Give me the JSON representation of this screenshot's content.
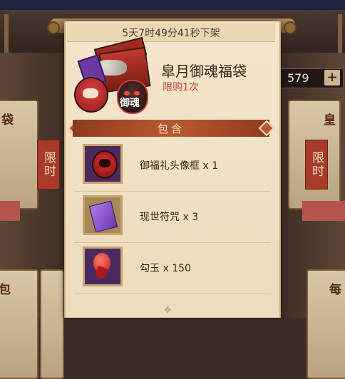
{
  "shop": {
    "currency_value": "579",
    "currency_plus": "+",
    "bg_labels": [
      "袋",
      "皇",
      "包",
      "每"
    ],
    "bg_tags": [
      "限时",
      "限时"
    ]
  },
  "popup": {
    "timer": "5天7时49分41秒下架",
    "title": "皐月御魂福袋",
    "limit": "限购1次",
    "bag_glyph": "御魂",
    "contains_label": "包含",
    "items": [
      {
        "name": "御福礼头像框",
        "qty": "x 1",
        "icon": "daruma-frame-icon"
      },
      {
        "name": "现世符咒",
        "qty": "x 3",
        "icon": "talisman-icon"
      },
      {
        "name": "勾玉",
        "qty": "x 150",
        "icon": "magatama-icon"
      }
    ]
  },
  "colors": {
    "accent": "#b85a30",
    "limit_red": "#c6422c",
    "panel": "#f3e6cc"
  }
}
